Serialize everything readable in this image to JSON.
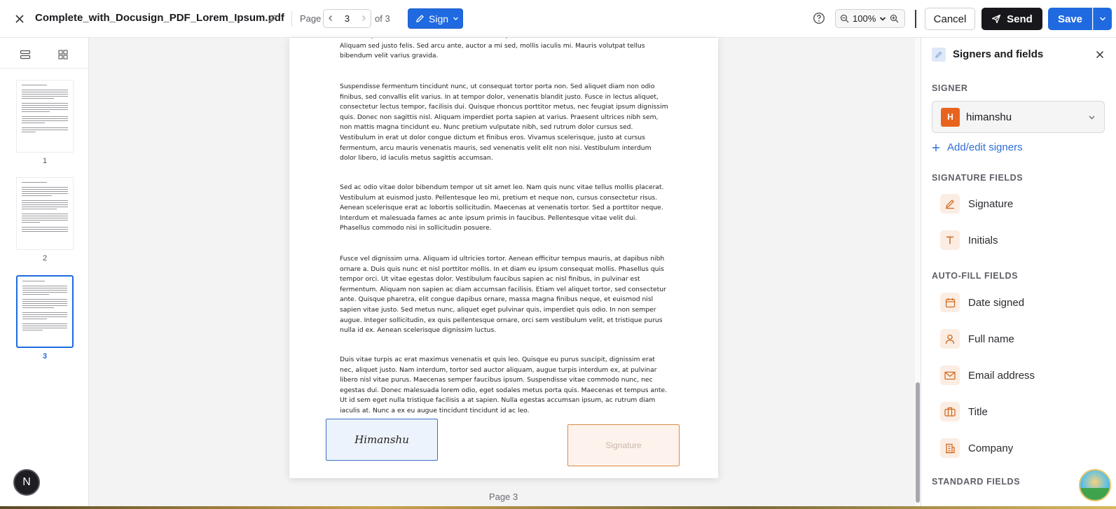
{
  "header": {
    "filename": "Complete_with_Docusign_PDF_Lorem_Ipsum.pdf",
    "page_label": "Page",
    "current_page": "3",
    "page_total": "of 3",
    "sign_label": "Sign",
    "zoom": "100%",
    "cancel_label": "Cancel",
    "send_label": "Send",
    "save_label": "Save"
  },
  "thumbnails": [
    {
      "label": "1"
    },
    {
      "label": "2"
    },
    {
      "label": "3"
    }
  ],
  "document": {
    "paragraphs": [
      "Pellentesque sed finibus massa. Nullam diam velit, porttitor vel sem sed, efficitur molestie felis. Aliquam sed justo felis. Sed arcu ante, auctor a mi sed, mollis iaculis mi. Mauris volutpat tellus bibendum velit varius gravida.",
      "Suspendisse fermentum tincidunt nunc, ut consequat tortor porta non. Sed aliquet diam non odio finibus, sed convallis elit varius. In at tempor dolor, venenatis blandit justo. Fusce in lectus aliquet, consectetur lectus tempor, facilisis dui. Quisque rhoncus porttitor metus, nec feugiat ipsum dignissim quis. Donec non sagittis nisl. Aliquam imperdiet porta sapien at varius. Praesent ultrices nibh sem, non mattis magna tincidunt eu. Nunc pretium vulputate nibh, sed rutrum dolor cursus sed. Vestibulum in erat ut dolor congue dictum et finibus eros. Vivamus scelerisque, justo at cursus fermentum, arcu mauris venenatis mauris, sed venenatis velit elit non nisi. Vestibulum interdum dolor libero, id iaculis metus sagittis accumsan.",
      "Sed ac odio vitae dolor bibendum tempor ut sit amet leo. Nam quis nunc vitae tellus mollis placerat. Vestibulum at euismod justo. Pellentesque leo mi, pretium et neque non, cursus consectetur risus. Aenean scelerisque erat ac lobortis sollicitudin. Maecenas at venenatis tortor. Sed a porttitor neque. Interdum et malesuada fames ac ante ipsum primis in faucibus. Pellentesque vitae velit dui. Phasellus commodo nisi in sollicitudin posuere.",
      "Fusce vel dignissim urna. Aliquam id ultricies tortor. Aenean efficitur tempus mauris, at dapibus nibh ornare a. Duis quis nunc et nisl porttitor mollis. In et diam eu ipsum consequat mollis. Phasellus quis tempor orci. Ut vitae egestas dolor. Vestibulum faucibus sapien ac nisl finibus, in pulvinar est fermentum. Aliquam non sapien ac diam accumsan facilisis. Etiam vel aliquet tortor, sed consectetur ante. Quisque pharetra, elit congue dapibus ornare, massa magna finibus neque, et euismod nisl sapien vitae justo. Sed metus nunc, aliquet eget pulvinar quis, imperdiet quis odio. In non semper augue. Integer sollicitudin, ex quis pellentesque ornare, orci sem vestibulum velit, et tristique purus nulla id ex. Aenean scelerisque dignissim luctus.",
      "Duis vitae turpis ac erat maximus venenatis et quis leo. Quisque eu purus suscipit, dignissim erat nec, aliquet justo. Nam interdum, tortor sed auctor aliquam, augue turpis interdum ex, at pulvinar libero nisl vitae purus. Maecenas semper faucibus ipsum. Suspendisse vitae commodo nunc, nec egestas dui. Donec malesuada lorem odio, eget sodales metus porta quis. Maecenas et tempus ante. Ut id sem eget nulla tristique facilisis a at sapien. Nulla egestas accumsan ipsum, ac rutrum diam iaculis at. Nunc a ex eu augue tincidunt tincidunt id ac leo."
    ],
    "signed_name": "Himanshu",
    "signature_placeholder": "Signature",
    "page_caption": "Page 3"
  },
  "panel": {
    "title": "Signers and fields",
    "signer_section": "SIGNER",
    "signer_initial": "H",
    "signer_name": "himanshu",
    "add_signers": "Add/edit signers",
    "signature_section": "SIGNATURE FIELDS",
    "signature_fields": [
      {
        "label": "Signature",
        "icon": "pen-icon"
      },
      {
        "label": "Initials",
        "icon": "text-t-icon"
      }
    ],
    "autofill_section": "AUTO-FILL FIELDS",
    "autofill_fields": [
      {
        "label": "Date signed",
        "icon": "calendar-icon"
      },
      {
        "label": "Full name",
        "icon": "person-icon"
      },
      {
        "label": "Email address",
        "icon": "envelope-icon"
      },
      {
        "label": "Title",
        "icon": "briefcase-icon"
      },
      {
        "label": "Company",
        "icon": "building-icon"
      }
    ],
    "standard_section": "STANDARD FIELDS"
  },
  "user": {
    "initial": "N"
  },
  "colors": {
    "accent_blue": "#1f6ae0",
    "signer_orange": "#e8641e",
    "send_black": "#17171c"
  }
}
